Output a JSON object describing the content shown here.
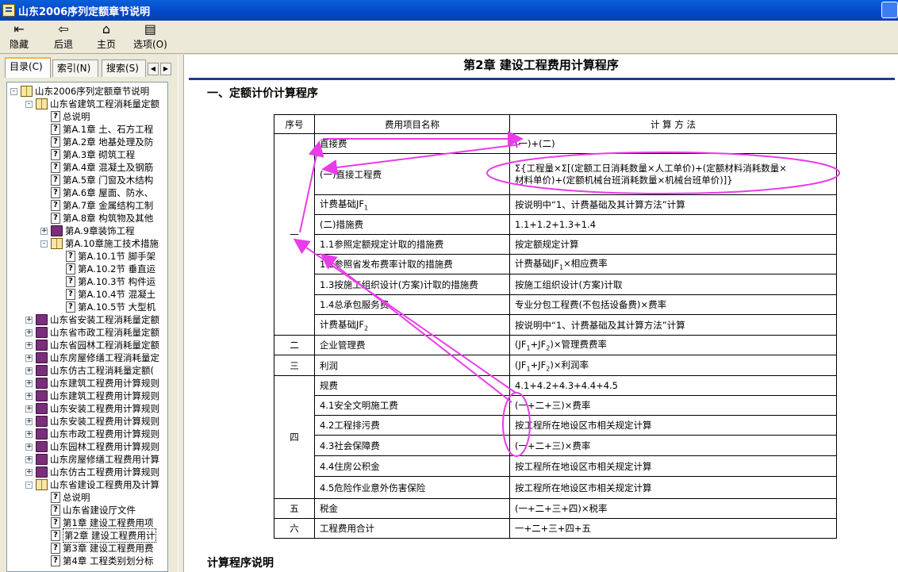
{
  "window": {
    "title": "山东2006序列定额章节说明"
  },
  "toolbar": {
    "hide": "隐藏",
    "back": "后退",
    "home": "主页",
    "options": "选项(O)"
  },
  "tabs": {
    "contents": "目录(C)",
    "index": "索引(N)",
    "search": "搜索(S)"
  },
  "tree": [
    {
      "label": "山东2006序列定额章节说明",
      "indent": 0,
      "icon": "openbook",
      "expander": "-"
    },
    {
      "label": "山东省建筑工程消耗量定额",
      "indent": 1,
      "icon": "openbook",
      "expander": "-"
    },
    {
      "label": "总说明",
      "indent": 2,
      "icon": "page",
      "expander": ""
    },
    {
      "label": "第A.1章 土、石方工程",
      "indent": 2,
      "icon": "page",
      "expander": ""
    },
    {
      "label": "第A.2章 地基处理及防",
      "indent": 2,
      "icon": "page",
      "expander": ""
    },
    {
      "label": "第A.3章 砌筑工程",
      "indent": 2,
      "icon": "page",
      "expander": ""
    },
    {
      "label": "第A.4章 混凝土及钢筋",
      "indent": 2,
      "icon": "page",
      "expander": ""
    },
    {
      "label": "第A.5章 门窗及木结构",
      "indent": 2,
      "icon": "page",
      "expander": ""
    },
    {
      "label": "第A.6章 屋面、防水、",
      "indent": 2,
      "icon": "page",
      "expander": ""
    },
    {
      "label": "第A.7章 金属结构工制",
      "indent": 2,
      "icon": "page",
      "expander": ""
    },
    {
      "label": "第A.8章 构筑物及其他",
      "indent": 2,
      "icon": "page",
      "expander": ""
    },
    {
      "label": "第A.9章装饰工程",
      "indent": 2,
      "icon": "closedbook",
      "expander": "+"
    },
    {
      "label": "第A.10章施工技术措施",
      "indent": 2,
      "icon": "openbook",
      "expander": "-"
    },
    {
      "label": "第A.10.1节 脚手架",
      "indent": 3,
      "icon": "page",
      "expander": ""
    },
    {
      "label": "第A.10.2节 垂直运",
      "indent": 3,
      "icon": "page",
      "expander": ""
    },
    {
      "label": "第A.10.3节 构件运",
      "indent": 3,
      "icon": "page",
      "expander": ""
    },
    {
      "label": "第A.10.4节 混凝土",
      "indent": 3,
      "icon": "page",
      "expander": ""
    },
    {
      "label": "第A.10.5节 大型机",
      "indent": 3,
      "icon": "page",
      "expander": ""
    },
    {
      "label": "山东省安装工程消耗量定额",
      "indent": 1,
      "icon": "closedbook",
      "expander": "+"
    },
    {
      "label": "山东省市政工程消耗量定额",
      "indent": 1,
      "icon": "closedbook",
      "expander": "+"
    },
    {
      "label": "山东省园林工程消耗量定额",
      "indent": 1,
      "icon": "closedbook",
      "expander": "+"
    },
    {
      "label": "山东房屋修缮工程消耗量定",
      "indent": 1,
      "icon": "closedbook",
      "expander": "+"
    },
    {
      "label": "山东仿古工程消耗量定额(",
      "indent": 1,
      "icon": "closedbook",
      "expander": "+"
    },
    {
      "label": "山东建筑工程费用计算规则",
      "indent": 1,
      "icon": "closedbook",
      "expander": "+"
    },
    {
      "label": "山东建筑工程费用计算规则",
      "indent": 1,
      "icon": "closedbook",
      "expander": "+"
    },
    {
      "label": "山东安装工程费用计算规则",
      "indent": 1,
      "icon": "closedbook",
      "expander": "+"
    },
    {
      "label": "山东安装工程费用计算规则",
      "indent": 1,
      "icon": "closedbook",
      "expander": "+"
    },
    {
      "label": "山东市政工程费用计算规则",
      "indent": 1,
      "icon": "closedbook",
      "expander": "+"
    },
    {
      "label": "山东园林工程费用计算规则",
      "indent": 1,
      "icon": "closedbook",
      "expander": "+"
    },
    {
      "label": "山东房屋修缮工程费用计算",
      "indent": 1,
      "icon": "closedbook",
      "expander": "+"
    },
    {
      "label": "山东仿古工程费用计算规则",
      "indent": 1,
      "icon": "closedbook",
      "expander": "+"
    },
    {
      "label": "山东省建设工程费用及计算",
      "indent": 1,
      "icon": "openbook",
      "expander": "-"
    },
    {
      "label": "总说明",
      "indent": 2,
      "icon": "page",
      "expander": ""
    },
    {
      "label": "山东省建设厅文件",
      "indent": 2,
      "icon": "page",
      "expander": ""
    },
    {
      "label": "第1章 建设工程费用项",
      "indent": 2,
      "icon": "page",
      "expander": ""
    },
    {
      "label": "第2章 建设工程费用计",
      "indent": 2,
      "icon": "page",
      "expander": "",
      "selected": true
    },
    {
      "label": "第3章 建设工程费用费",
      "indent": 2,
      "icon": "page",
      "expander": ""
    },
    {
      "label": "第4章 工程类别划分标",
      "indent": 2,
      "icon": "page",
      "expander": ""
    }
  ],
  "main": {
    "chapter_title": "第2章 建设工程费用计算程序",
    "section_heading": "一、定额计价计算程序",
    "subsection_heading": "计算程序说明",
    "table_headers": [
      "序号",
      "费用项目名称",
      "计 算 方 法"
    ],
    "rows": [
      {
        "seq": "一",
        "name": "直接费",
        "method": "(一)+(二)"
      },
      {
        "seq": "",
        "name": "(一)直接工程费",
        "method": "Σ{工程量×Σ[(定额工日消耗数量×人工单价)+(定额材料消耗数量×",
        "method2": "材料单价)+(定额机械台班消耗数量×机械台班单价)]}"
      },
      {
        "seq": "",
        "name": "计费基础JF",
        "name_sub": "1",
        "method": "按说明中“1、计费基础及其计算方法”计算"
      },
      {
        "seq": "",
        "name": "(二)措施费",
        "method": "1.1+1.2+1.3+1.4"
      },
      {
        "seq": "",
        "name": "1.1参照定额规定计取的措施费",
        "method": "按定额规定计算"
      },
      {
        "seq": "",
        "name": "1.2参照省发布费率计取的措施费",
        "method": "计费基础JF",
        "method_sub": "1",
        "method_tail": "×相应费率"
      },
      {
        "seq": "",
        "name": "1.3按施工组织设计(方案)计取的措施费",
        "method": "按施工组织设计(方案)计取"
      },
      {
        "seq": "",
        "name": "1.4总承包服务费",
        "method": "专业分包工程费(不包括设备费)×费率"
      },
      {
        "seq": "",
        "name": "计费基础JF",
        "name_sub": "2",
        "method": "按说明中“1、计费基础及其计算方法”计算"
      },
      {
        "seq": "二",
        "name": "企业管理费",
        "method": "(JF",
        "method_sub": "1",
        "method_mid": "+JF",
        "method_sub2": "2",
        "method_tail": ")×管理费费率"
      },
      {
        "seq": "三",
        "name": "利润",
        "method": "(JF",
        "method_sub": "1",
        "method_mid": "+JF",
        "method_sub2": "2",
        "method_tail": ")×利润率"
      },
      {
        "seq": "四",
        "name": "规费",
        "method": "4.1+4.2+4.3+4.4+4.5"
      },
      {
        "seq": "",
        "name": "4.1安全文明施工费",
        "method": "(一+二+三)×费率"
      },
      {
        "seq": "",
        "name": "4.2工程排污费",
        "method": "按工程所在地设区市相关规定计算"
      },
      {
        "seq": "",
        "name": "4.3社会保障费",
        "method": "(一+二+三)×费率"
      },
      {
        "seq": "",
        "name": "4.4住房公积金",
        "method": "按工程所在地设区市相关规定计算"
      },
      {
        "seq": "",
        "name": "4.5危险作业意外伤害保险",
        "method": "按工程所在地设区市相关规定计算"
      },
      {
        "seq": "五",
        "name": "税金",
        "method": "(一+二+三+四)×税率"
      },
      {
        "seq": "六",
        "name": "工程费用合计",
        "method": "一+二+三+四+五"
      }
    ]
  },
  "colors": {
    "annotation": "#e83ce8",
    "titlebar": "#0348c9",
    "title_rule": "#1f3d8a"
  }
}
